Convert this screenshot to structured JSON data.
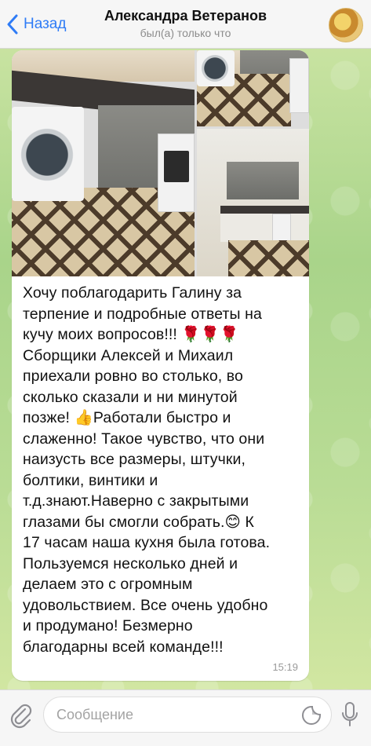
{
  "header": {
    "back_label": "Назад",
    "contact_name": "Александра Ветеранов",
    "status": "был(а) только что"
  },
  "message": {
    "lines": [
      "Хочу поблагодарить Галину за",
      "терпение и подробные ответы на",
      "кучу моих вопросов!!! 🌹🌹🌹",
      "Сборщики Алексей и Михаил",
      "приехали ровно во столько, во",
      "сколько сказали и ни минутой",
      "позже! 👍Работали быстро и",
      "слаженно! Такое чувство, что они",
      "наизусть все размеры, штучки,",
      "болтики, винтики и",
      "т.д.знают.Наверно с закрытыми",
      "глазами бы смогли собрать.😊 К",
      "17 часам наша кухня была готова.",
      "Пользуемся несколько дней и",
      "делаем это с огромным",
      "удовольствием. Все очень удобно",
      "и продумано! Безмерно",
      "благодарны всей команде!!!"
    ],
    "time": "15:19"
  },
  "composer": {
    "placeholder": "Сообщение"
  },
  "icons": {
    "back": "chevron-left-icon",
    "avatar": "avatar",
    "attach": "paperclip-icon",
    "sticker": "sticker-icon",
    "mic": "microphone-icon"
  },
  "colors": {
    "accent": "#2f7cf6",
    "bubble": "#ffffff",
    "header_bg": "#f6f6f6",
    "chat_bg": "#b3d890"
  }
}
